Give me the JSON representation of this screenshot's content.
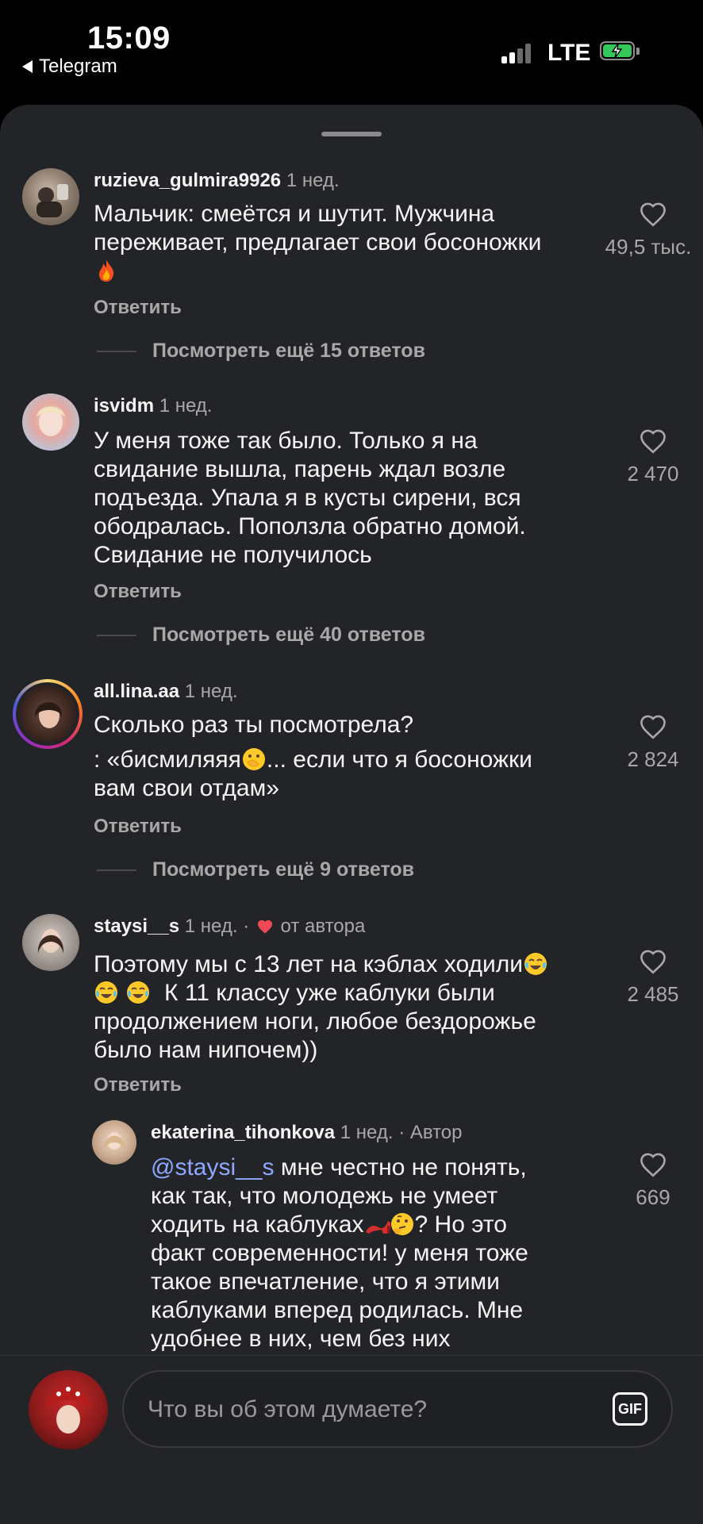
{
  "status_bar": {
    "time": "15:09",
    "back_app": "Telegram",
    "network": "LTE",
    "battery_level": 0.85
  },
  "comments": [
    {
      "username": "ruzieva_gulmira9926",
      "meta": "1 нед.",
      "line1": "Мальчик: смеётся и шутит.  Мужчина",
      "line2": "переживает,  предлагает свои босоножки",
      "emoji": "fire",
      "reply": "Ответить",
      "likes": "49,5 тыс.",
      "more": "Посмотреть ещё 15 ответов"
    },
    {
      "username": "isvidm",
      "meta": "1 нед.",
      "lines": [
        "У меня тоже так было. Только я на",
        "свидание вышла, парень ждал возле",
        "подъезда. Упала я в кусты сирени, вся",
        "ободралась. Поползла обратно домой.",
        "Свидание не получилось"
      ],
      "reply": "Ответить",
      "likes": "2 470",
      "more": "Посмотреть ещё 40 ответов"
    },
    {
      "username": "all.lina.aa",
      "meta": "1 нед.",
      "line1": "Сколько раз ты посмотрела?",
      "line2_a": ": «бисмиляяя",
      "line2_b": "... если что я босоножки",
      "line3": "вам свои отдам»",
      "reply": "Ответить",
      "likes": "2 824",
      "more": "Посмотреть ещё 9 ответов"
    },
    {
      "username": "staysi__s",
      "meta": "1 нед. ·",
      "author_badge": "от автора",
      "line1": "Поэтому мы с 13 лет на кэблах ходили",
      "line2": "К 11 классу уже каблуки были",
      "line3": "продолжением ноги, любое бездорожье",
      "line4": "было нам нипочем))",
      "reply": "Ответить",
      "likes": "2 485"
    },
    {
      "username": "ekaterina_tihonkova",
      "meta": "1 нед. · Автор",
      "mention": "@staysi__s",
      "line1": "мне честно не понять,",
      "line2": "как так, что молодежь не умеет",
      "line3_a": "ходить на каблуках",
      "line3_b": "? Но это",
      "line4": "факт современности! у меня тоже",
      "line5": "такое впечатление, что я этими",
      "line6": "каблуками вперед родилась. Мне",
      "line7": "удобнее в них, чем без них",
      "likes": "669"
    }
  ],
  "composer": {
    "placeholder": "Что вы об этом думаете?",
    "gif_label": "GIF"
  },
  "colors": {
    "sheet_bg": "#232427",
    "muted_text": "#a8a8a8",
    "mention": "#8ea7ff",
    "story_ring": "#e1306c",
    "author_heart": "#ed4956"
  }
}
